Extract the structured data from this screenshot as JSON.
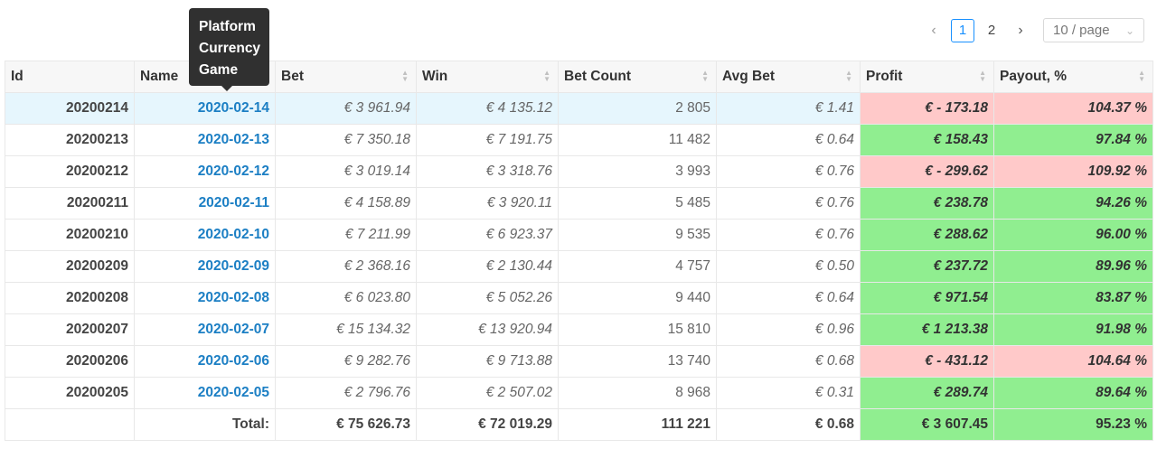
{
  "pagination": {
    "prev_icon": "‹",
    "next_icon": "›",
    "pages": [
      "1",
      "2"
    ],
    "active_page": "1",
    "page_size": "10 / page"
  },
  "tooltip": {
    "lines": [
      "Platform",
      "Currency",
      "Game"
    ]
  },
  "table": {
    "columns": [
      "Id",
      "Name",
      "Bet",
      "Win",
      "Bet Count",
      "Avg Bet",
      "Profit",
      "Payout, %"
    ],
    "rows": [
      {
        "id": "20200214",
        "name": "2020-02-14",
        "bet": "€ 3 961.94",
        "win": "€ 4 135.12",
        "count": "2 805",
        "avg": "€ 1.41",
        "profit": "€ - 173.18",
        "payout": "104.37 %",
        "status": "neg"
      },
      {
        "id": "20200213",
        "name": "2020-02-13",
        "bet": "€ 7 350.18",
        "win": "€ 7 191.75",
        "count": "11 482",
        "avg": "€ 0.64",
        "profit": "€ 158.43",
        "payout": "97.84 %",
        "status": "pos"
      },
      {
        "id": "20200212",
        "name": "2020-02-12",
        "bet": "€ 3 019.14",
        "win": "€ 3 318.76",
        "count": "3 993",
        "avg": "€ 0.76",
        "profit": "€ - 299.62",
        "payout": "109.92 %",
        "status": "neg"
      },
      {
        "id": "20200211",
        "name": "2020-02-11",
        "bet": "€ 4 158.89",
        "win": "€ 3 920.11",
        "count": "5 485",
        "avg": "€ 0.76",
        "profit": "€ 238.78",
        "payout": "94.26 %",
        "status": "pos"
      },
      {
        "id": "20200210",
        "name": "2020-02-10",
        "bet": "€ 7 211.99",
        "win": "€ 6 923.37",
        "count": "9 535",
        "avg": "€ 0.76",
        "profit": "€ 288.62",
        "payout": "96.00 %",
        "status": "pos"
      },
      {
        "id": "20200209",
        "name": "2020-02-09",
        "bet": "€ 2 368.16",
        "win": "€ 2 130.44",
        "count": "4 757",
        "avg": "€ 0.50",
        "profit": "€ 237.72",
        "payout": "89.96 %",
        "status": "pos"
      },
      {
        "id": "20200208",
        "name": "2020-02-08",
        "bet": "€ 6 023.80",
        "win": "€ 5 052.26",
        "count": "9 440",
        "avg": "€ 0.64",
        "profit": "€ 971.54",
        "payout": "83.87 %",
        "status": "pos"
      },
      {
        "id": "20200207",
        "name": "2020-02-07",
        "bet": "€ 15 134.32",
        "win": "€ 13 920.94",
        "count": "15 810",
        "avg": "€ 0.96",
        "profit": "€ 1 213.38",
        "payout": "91.98 %",
        "status": "pos"
      },
      {
        "id": "20200206",
        "name": "2020-02-06",
        "bet": "€ 9 282.76",
        "win": "€ 9 713.88",
        "count": "13 740",
        "avg": "€ 0.68",
        "profit": "€ - 431.12",
        "payout": "104.64 %",
        "status": "neg"
      },
      {
        "id": "20200205",
        "name": "2020-02-05",
        "bet": "€ 2 796.76",
        "win": "€ 2 507.02",
        "count": "8 968",
        "avg": "€ 0.31",
        "profit": "€ 289.74",
        "payout": "89.64 %",
        "status": "pos"
      }
    ],
    "total": {
      "label": "Total:",
      "bet": "€ 75 626.73",
      "win": "€ 72 019.29",
      "count": "111 221",
      "avg": "€ 0.68",
      "profit": "€ 3 607.45",
      "payout": "95.23 %",
      "status": "pos"
    }
  },
  "colors": {
    "profit_positive": "#90ee90",
    "profit_negative": "#ffc9c9",
    "link": "#1c7fc4",
    "active_page": "#1890ff",
    "highlight_row": "#e6f6fd"
  },
  "icons": {
    "sort": "sort-caret-icon",
    "page_size_chevron": "chevron-down-icon"
  }
}
